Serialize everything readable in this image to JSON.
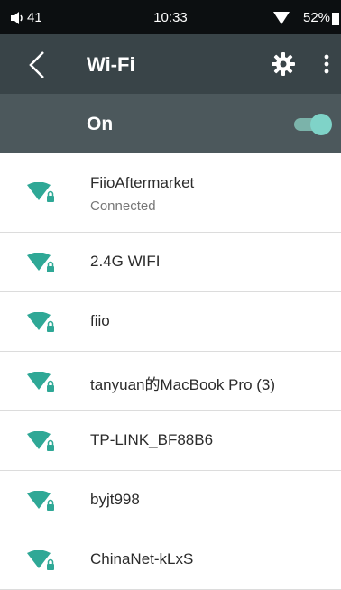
{
  "status_bar": {
    "volume": "41",
    "time": "10:33",
    "battery": "52%"
  },
  "toolbar": {
    "title": "Wi-Fi",
    "back_icon": "chevron-left-icon",
    "settings_icon": "gear-icon",
    "more_icon": "more-vert-icon"
  },
  "wifi_toggle": {
    "label": "On",
    "state": true
  },
  "colors": {
    "status_bar_bg": "#0c0f11",
    "toolbar_bg": "#394448",
    "toggle_row_bg": "#4c585c",
    "accent": "#2fa896",
    "switch_thumb": "#7fd3c8"
  },
  "networks": [
    {
      "name": "FiioAftermarket",
      "status": "Connected"
    },
    {
      "name": "2.4G WIFI"
    },
    {
      "name": "fiio"
    },
    {
      "name": "tanyuan的MacBook Pro (3)"
    },
    {
      "name": "TP-LINK_BF88B6"
    },
    {
      "name": "byjt998"
    },
    {
      "name": "ChinaNet-kLxS"
    }
  ]
}
